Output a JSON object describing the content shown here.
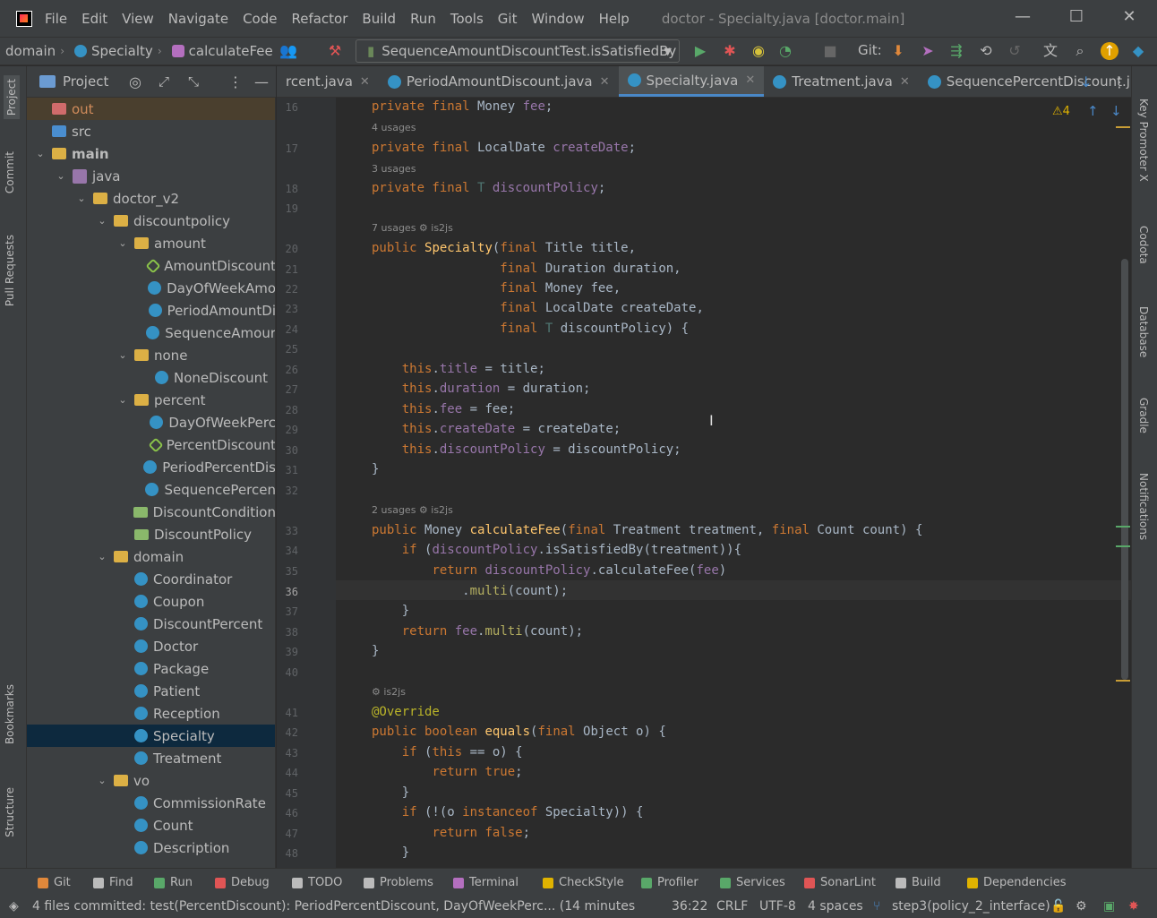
{
  "window": {
    "title": "doctor - Specialty.java [doctor.main]"
  },
  "menu": [
    "File",
    "Edit",
    "View",
    "Navigate",
    "Code",
    "Refactor",
    "Build",
    "Run",
    "Tools",
    "Git",
    "Window",
    "Help"
  ],
  "breadcrumb": {
    "a": "domain",
    "b": "Specialty",
    "c": "calculateFee"
  },
  "run_config": "SequenceAmountDiscountTest.isSatisfiedBy",
  "git_label": "Git:",
  "project_panel": {
    "title": "Project"
  },
  "tree": [
    {
      "label": "out",
      "depth": 0,
      "icon": "out",
      "arrow": ""
    },
    {
      "label": "src",
      "depth": 0,
      "icon": "src",
      "arrow": ""
    },
    {
      "label": "main",
      "depth": 0,
      "icon": "folder",
      "arrow": "v"
    },
    {
      "label": "java",
      "depth": 1,
      "icon": "pkg",
      "arrow": "v"
    },
    {
      "label": "doctor_v2",
      "depth": 2,
      "icon": "folder",
      "arrow": "v"
    },
    {
      "label": "discountpolicy",
      "depth": 3,
      "icon": "folder",
      "arrow": "v"
    },
    {
      "label": "amount",
      "depth": 4,
      "icon": "folder",
      "arrow": "v"
    },
    {
      "label": "AmountDiscount",
      "depth": 5,
      "icon": "iface",
      "arrow": ""
    },
    {
      "label": "DayOfWeekAmo",
      "depth": 5,
      "icon": "cls",
      "arrow": ""
    },
    {
      "label": "PeriodAmountDi",
      "depth": 5,
      "icon": "cls",
      "arrow": ""
    },
    {
      "label": "SequenceAmour",
      "depth": 5,
      "icon": "cls",
      "arrow": ""
    },
    {
      "label": "none",
      "depth": 4,
      "icon": "folder",
      "arrow": "v"
    },
    {
      "label": "NoneDiscount",
      "depth": 5,
      "icon": "cls",
      "arrow": ""
    },
    {
      "label": "percent",
      "depth": 4,
      "icon": "folder",
      "arrow": "v"
    },
    {
      "label": "DayOfWeekPerc",
      "depth": 5,
      "icon": "cls",
      "arrow": ""
    },
    {
      "label": "PercentDiscount",
      "depth": 5,
      "icon": "iface",
      "arrow": ""
    },
    {
      "label": "PeriodPercentDis",
      "depth": 5,
      "icon": "cls",
      "arrow": ""
    },
    {
      "label": "SequencePercen",
      "depth": 5,
      "icon": "cls",
      "arrow": ""
    },
    {
      "label": "DiscountCondition",
      "depth": 4,
      "icon": "enum",
      "arrow": ""
    },
    {
      "label": "DiscountPolicy",
      "depth": 4,
      "icon": "enum",
      "arrow": ""
    },
    {
      "label": "domain",
      "depth": 3,
      "icon": "folder",
      "arrow": "v"
    },
    {
      "label": "Coordinator",
      "depth": 4,
      "icon": "cls",
      "arrow": ""
    },
    {
      "label": "Coupon",
      "depth": 4,
      "icon": "cls",
      "arrow": ""
    },
    {
      "label": "DiscountPercent",
      "depth": 4,
      "icon": "cls",
      "arrow": ""
    },
    {
      "label": "Doctor",
      "depth": 4,
      "icon": "cls",
      "arrow": ""
    },
    {
      "label": "Package",
      "depth": 4,
      "icon": "cls",
      "arrow": ""
    },
    {
      "label": "Patient",
      "depth": 4,
      "icon": "cls",
      "arrow": ""
    },
    {
      "label": "Reception",
      "depth": 4,
      "icon": "cls",
      "arrow": ""
    },
    {
      "label": "Specialty",
      "depth": 4,
      "icon": "cls",
      "arrow": "",
      "selected": true
    },
    {
      "label": "Treatment",
      "depth": 4,
      "icon": "cls",
      "arrow": ""
    },
    {
      "label": "vo",
      "depth": 3,
      "icon": "folder",
      "arrow": "v"
    },
    {
      "label": "CommissionRate",
      "depth": 4,
      "icon": "cls",
      "arrow": ""
    },
    {
      "label": "Count",
      "depth": 4,
      "icon": "cls",
      "arrow": ""
    },
    {
      "label": "Description",
      "depth": 4,
      "icon": "cls",
      "arrow": ""
    }
  ],
  "tabs": [
    {
      "label": "rcent.java",
      "active": false
    },
    {
      "label": "PeriodAmountDiscount.java",
      "active": false
    },
    {
      "label": "Specialty.java",
      "active": true
    },
    {
      "label": "Treatment.java",
      "active": false
    },
    {
      "label": "SequencePercentDiscount.j",
      "active": false
    }
  ],
  "warnings": "4",
  "code": [
    {
      "n": "16",
      "html": "<span class='kw'>private final</span> Money <span class='fld'>fee</span>;"
    },
    {
      "hint": "4 usages"
    },
    {
      "n": "17",
      "html": "<span class='kw'>private final</span> LocalDate <span class='fld'>createDate</span>;"
    },
    {
      "hint": "3 usages"
    },
    {
      "n": "18",
      "html": "<span class='kw'>private final</span> <span class='tp'>T</span> <span class='fld'>discountPolicy</span>;"
    },
    {
      "n": "19",
      "html": ""
    },
    {
      "hint": "7 usages   ⚙ is2js"
    },
    {
      "n": "20",
      "html": "<span class='kw'>public</span> <span class='fn'>Specialty</span>(<span class='kw'>final</span> Title title,"
    },
    {
      "n": "21",
      "html": "                 <span class='kw'>final</span> Duration duration,"
    },
    {
      "n": "22",
      "html": "                 <span class='kw'>final</span> Money fee,"
    },
    {
      "n": "23",
      "html": "                 <span class='kw'>final</span> LocalDate createDate,"
    },
    {
      "n": "24",
      "html": "                 <span class='kw'>final</span> <span class='tp'>T</span> discountPolicy) {"
    },
    {
      "n": "25",
      "html": ""
    },
    {
      "n": "26",
      "html": "    <span class='kw'>this</span>.<span class='fld'>title</span> = title;"
    },
    {
      "n": "27",
      "html": "    <span class='kw'>this</span>.<span class='fld'>duration</span> = duration;"
    },
    {
      "n": "28",
      "html": "    <span class='kw'>this</span>.<span class='fld'>fee</span> = fee;"
    },
    {
      "n": "29",
      "html": "    <span class='kw'>this</span>.<span class='fld'>createDate</span> = createDate;"
    },
    {
      "n": "30",
      "html": "    <span class='kw'>this</span>.<span class='fld'>discountPolicy</span> = discountPolicy;"
    },
    {
      "n": "31",
      "html": "}"
    },
    {
      "n": "32",
      "html": ""
    },
    {
      "hint": "2 usages   ⚙ is2js"
    },
    {
      "n": "33",
      "html": "<span class='kw'>public</span> Money <span class='fn'>calculateFee</span>(<span class='kw'>final</span> Treatment treatment, <span class='kw'>final</span> Count count) {"
    },
    {
      "n": "34",
      "html": "    <span class='kw'>if</span> (<span class='fld'>discountPolicy</span>.isSatisfiedBy(treatment)){"
    },
    {
      "n": "35",
      "html": "        <span class='kw'>return</span> <span class='fld'>discountPolicy</span>.calculateFee(<span class='fld'>fee</span>)"
    },
    {
      "n": "36",
      "html": "            .<span class='fnc'>multi</span>(count);"
    },
    {
      "n": "37",
      "html": "    }"
    },
    {
      "n": "38",
      "html": "    <span class='kw'>return</span> <span class='fld'>fee</span>.<span class='fnc'>multi</span>(count);"
    },
    {
      "n": "39",
      "html": "}"
    },
    {
      "n": "40",
      "html": ""
    },
    {
      "hint": "⚙ is2js"
    },
    {
      "n": "41",
      "html": "<span class='an'>@Override</span>"
    },
    {
      "n": "42",
      "html": "<span class='kw'>public boolean</span> <span class='fn'>equals</span>(<span class='kw'>final</span> Object o) {"
    },
    {
      "n": "43",
      "html": "    <span class='kw'>if</span> (<span class='kw'>this</span> == o) {"
    },
    {
      "n": "44",
      "html": "        <span class='kw'>return true</span>;"
    },
    {
      "n": "45",
      "html": "    }"
    },
    {
      "n": "46",
      "html": "    <span class='kw'>if</span> (!(o <span class='kw'>instanceof</span> Specialty)) {"
    },
    {
      "n": "47",
      "html": "        <span class='kw'>return false</span>;"
    },
    {
      "n": "48",
      "html": "    }"
    }
  ],
  "left_tabs": [
    "Project",
    "Commit",
    "Pull Requests",
    "Bookmarks",
    "Structure"
  ],
  "right_tabs": [
    "Key Promoter X",
    "Codota",
    "Database",
    "Gradle",
    "Notifications"
  ],
  "toolwindows": [
    "Git",
    "Find",
    "Run",
    "Debug",
    "TODO",
    "Problems",
    "Terminal",
    "CheckStyle",
    "Profiler",
    "Services",
    "SonarLint",
    "Build",
    "Dependencies"
  ],
  "status": {
    "message": "4 files committed: test(PercentDiscount): PeriodPercentDiscount, DayOfWeekPerc... (14 minutes ago",
    "position": "36:22",
    "line_sep": "CRLF",
    "encoding": "UTF-8",
    "indent": "4 spaces",
    "branch": "step3(policy_2_interface)"
  }
}
